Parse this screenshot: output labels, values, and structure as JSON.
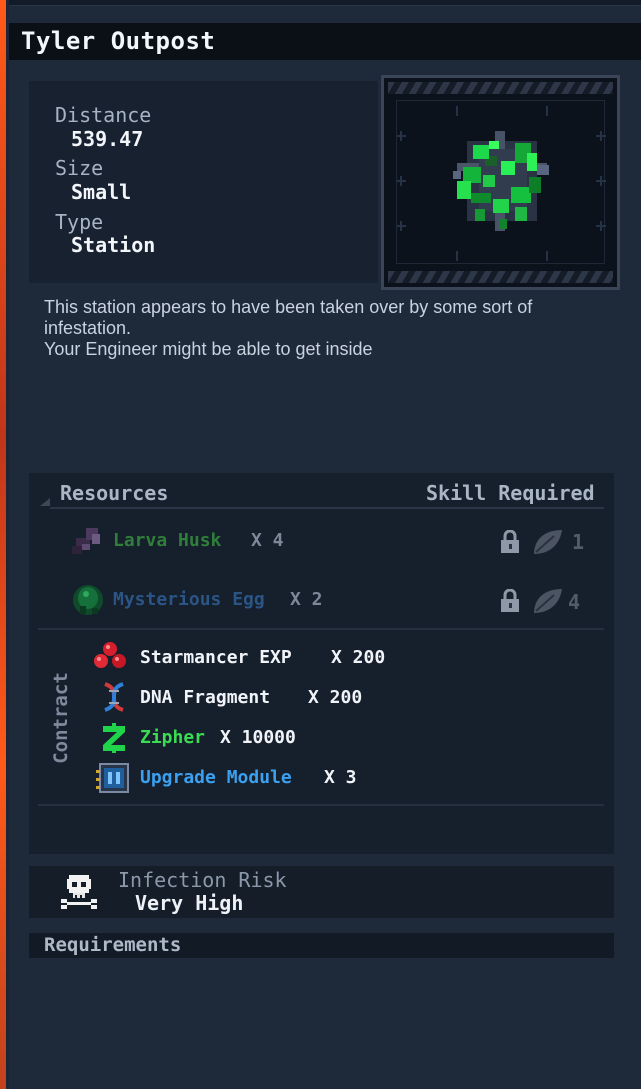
{
  "title": "Tyler Outpost",
  "info": {
    "distance_label": "Distance",
    "distance_value": "539.47",
    "size_label": "Size",
    "size_value": "Small",
    "type_label": "Type",
    "type_value": "Station"
  },
  "description": {
    "line1": "This station appears to have been taken over by some sort of",
    "line2": "infestation.",
    "line3": "Your Engineer might be able to get inside"
  },
  "resources": {
    "header_left": "Resources",
    "header_right": "Skill Required",
    "items": [
      {
        "name": "Larva Husk",
        "qty": "X 4",
        "skill": "1",
        "color": "#2f7f3a"
      },
      {
        "name": "Mysterious Egg",
        "qty": "X 2",
        "skill": "4",
        "color": "#2a5585"
      }
    ]
  },
  "contract": {
    "label": "Contract",
    "items": [
      {
        "name": "Starmancer EXP",
        "qty": "X 200",
        "color": "#f0f3f7",
        "icon": "red-orbs-icon"
      },
      {
        "name": "DNA Fragment",
        "qty": "X 200",
        "color": "#f0f3f7",
        "icon": "dna-icon"
      },
      {
        "name": "Zipher",
        "qty": "X 10000",
        "color": "#3adc52",
        "icon": "zipher-z-icon"
      },
      {
        "name": "Upgrade Module",
        "qty": "X 3",
        "color": "#3aa0ef",
        "icon": "upgrade-module-icon"
      }
    ]
  },
  "risk": {
    "label": "Infection Risk",
    "value": "Very High"
  },
  "requirements": {
    "label": "Requirements"
  }
}
